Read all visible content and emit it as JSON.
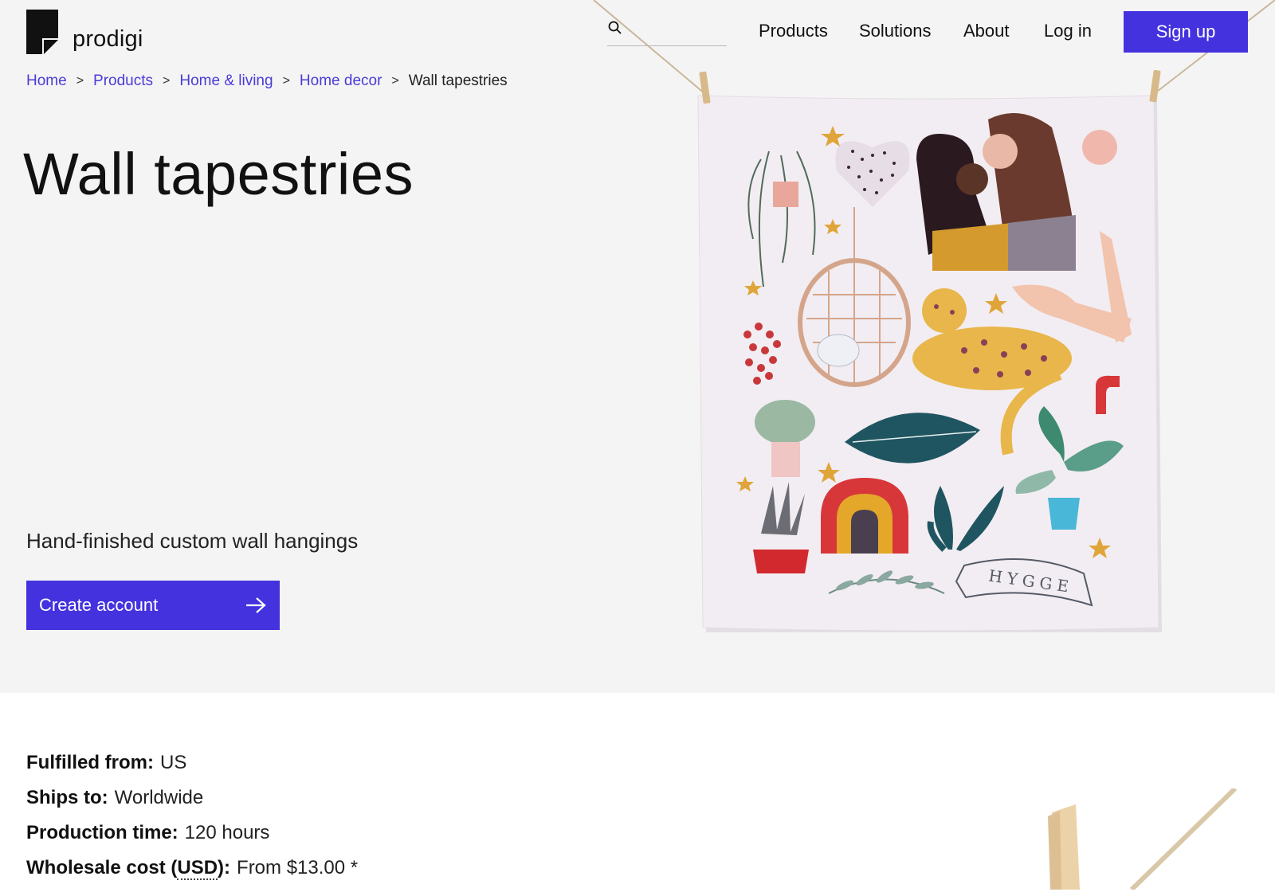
{
  "brand": {
    "name": "prodigi"
  },
  "nav": {
    "search_placeholder": "",
    "links": [
      {
        "label": "Products"
      },
      {
        "label": "Solutions"
      },
      {
        "label": "About"
      },
      {
        "label": "Log in"
      }
    ],
    "signup_label": "Sign up"
  },
  "breadcrumb": {
    "items": [
      {
        "label": "Home"
      },
      {
        "label": "Products"
      },
      {
        "label": "Home & living"
      },
      {
        "label": "Home decor"
      }
    ],
    "separator": ">",
    "current": "Wall tapestries"
  },
  "hero": {
    "title": "Wall tapestries",
    "subtitle": "Hand-finished custom wall hangings",
    "cta_label": "Create account",
    "tapestry_banner_text": "HYGGE"
  },
  "specs": [
    {
      "label": "Fulfilled from:",
      "value": "US"
    },
    {
      "label": "Ships to:",
      "value": "Worldwide"
    },
    {
      "label": "Production time:",
      "value": "120 hours"
    },
    {
      "label_prefix": "Wholesale cost (",
      "label_abbr": "USD",
      "label_suffix": "):",
      "value": "From $13.00 *"
    }
  ],
  "colors": {
    "accent": "#4432df",
    "link": "#4a3bd8",
    "hero_background": "#f4f4f4"
  },
  "icons": [
    "search-icon",
    "arrow-right-icon"
  ]
}
